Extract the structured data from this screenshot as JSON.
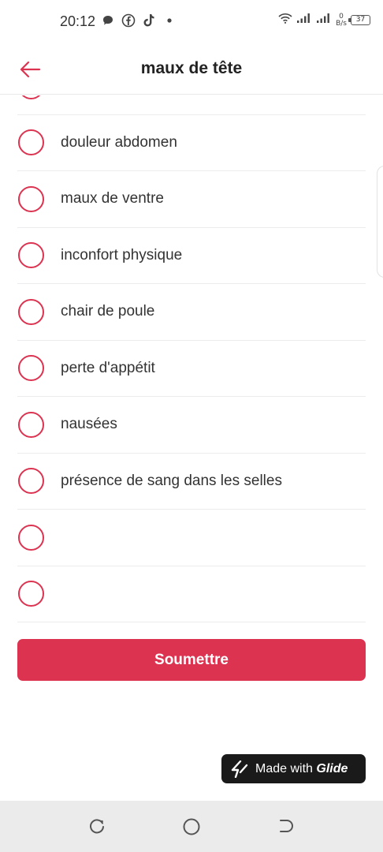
{
  "status_bar": {
    "time": "20:12",
    "net_speed_value": "0",
    "net_speed_unit": "B/s",
    "battery": "37",
    "left_icons": [
      "chat-bubble-icon",
      "facebook-icon",
      "tiktok-icon",
      "dot-icon"
    ],
    "right_icons": [
      "wifi-icon",
      "signal-icon",
      "signal-icon"
    ]
  },
  "header": {
    "title": "maux de tête",
    "back_icon": "arrow-left-icon"
  },
  "list": {
    "items": [
      {
        "label": ""
      },
      {
        "label": "douleur abdomen"
      },
      {
        "label": "maux de ventre"
      },
      {
        "label": "inconfort physique"
      },
      {
        "label": "chair de poule"
      },
      {
        "label": "perte d'appétit"
      },
      {
        "label": "nausées"
      },
      {
        "label": "présence de sang dans les selles"
      },
      {
        "label": ""
      },
      {
        "label": ""
      }
    ]
  },
  "submit": {
    "label": "Soumettre"
  },
  "badge": {
    "prefix": "Made with",
    "brand": "Glide",
    "icon": "glide-bolt-icon"
  },
  "nav": {
    "buttons": [
      "recent-apps-icon",
      "home-icon",
      "back-icon"
    ]
  },
  "colors": {
    "accent": "#dc3351",
    "badge_bg": "#1a1a1a",
    "nav_bg": "#ebebeb",
    "divider": "#ececee"
  }
}
